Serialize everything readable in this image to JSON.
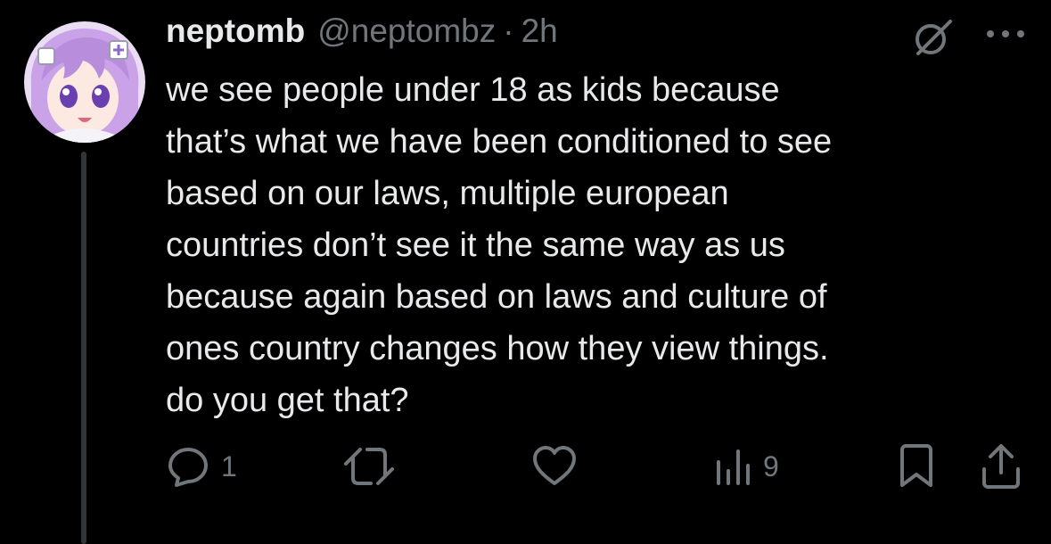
{
  "post": {
    "author": {
      "display_name": "neptomb",
      "handle": "@neptombz",
      "separator": "·",
      "time": "2h",
      "avatar_icon": "anime-girl-avatar"
    },
    "text_lines": [
      "we see people under 18 as kids because",
      "that’s what we have been conditioned to see",
      "based on our laws, multiple european",
      "countries don’t see it the same way as us",
      "because again based on laws and culture of",
      "ones country changes how they view things.",
      "do you get that?"
    ],
    "actions": {
      "reply": {
        "icon": "reply-icon",
        "count": "1"
      },
      "repost": {
        "icon": "repost-icon",
        "count": ""
      },
      "like": {
        "icon": "heart-icon",
        "count": ""
      },
      "views": {
        "icon": "views-icon",
        "count": "9"
      },
      "bookmark": {
        "icon": "bookmark-icon"
      },
      "share": {
        "icon": "share-icon"
      }
    },
    "header_icons": [
      "grok-icon",
      "more-icon"
    ]
  },
  "colors": {
    "background": "#000000",
    "text": "#e7e9ea",
    "secondary": "#71767b",
    "thread_line": "#333639",
    "avatar_hair": "#c9a2e8",
    "avatar_eyes": "#6b3fb0"
  }
}
